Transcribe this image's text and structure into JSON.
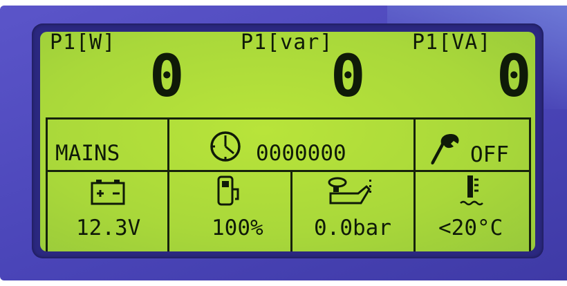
{
  "readings": [
    {
      "label": "P1[W]",
      "value": "0"
    },
    {
      "label": "P1[var]",
      "value": "0"
    },
    {
      "label": "P1[VA]",
      "value": "0"
    }
  ],
  "status": {
    "mode": "MAINS",
    "hours_counter": "0000000",
    "maintenance_state": "OFF"
  },
  "gauges": {
    "battery_voltage": "12.3V",
    "fuel_level": "100%",
    "oil_pressure": "0.0bar",
    "coolant_temperature": "<20°C"
  },
  "icons": {
    "clock": "clock-icon",
    "wrench": "wrench-icon",
    "battery": "battery-icon",
    "fuel": "fuel-pump-icon",
    "oil": "oil-can-icon",
    "temperature": "thermometer-icon"
  },
  "colors": {
    "lcd_background": "#aad93a",
    "lcd_foreground": "#0f1a08",
    "housing": "#4a45b8"
  }
}
